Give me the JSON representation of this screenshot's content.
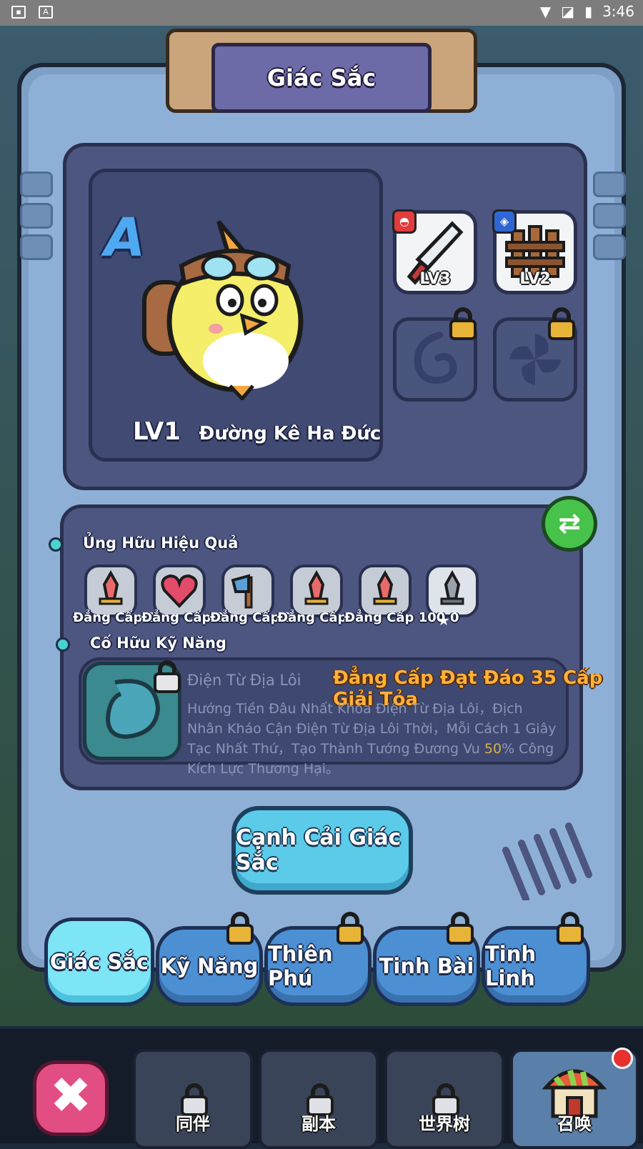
{
  "status_bar": {
    "time": "3:46",
    "icons": [
      "image-icon",
      "text-icon",
      "wifi-icon",
      "no-sim-icon",
      "battery-charging-icon"
    ]
  },
  "title": "Giác Sắc",
  "character": {
    "grade": "A",
    "level": "LV1",
    "name": "Đường Kê Ha Đức"
  },
  "equipment": [
    {
      "label": "LV3",
      "icon": "knife-icon",
      "badge": "bell-icon",
      "badge_color": "#e23c3c"
    },
    {
      "label": "LV2",
      "icon": "fence-icon",
      "badge": "shield-icon",
      "badge_color": "#2e66d6"
    },
    {
      "label": "",
      "icon": "swirl-icon",
      "locked": true
    },
    {
      "label": "",
      "icon": "fan-icon",
      "locked": true
    }
  ],
  "effects": {
    "section_title": "Ủng Hữu Hiệu Quả",
    "buffs": [
      {
        "icon": "sword-icon",
        "label": "Đẳng Cấp 1"
      },
      {
        "icon": "heart-icon",
        "label": "Đẳng Cấp 2"
      },
      {
        "icon": "axe-icon",
        "label": "Đẳng Cấp 5"
      },
      {
        "icon": "sword-icon",
        "label": "Đẳng Cấp"
      },
      {
        "icon": "sword-icon",
        "label": "Đẳng Cấp 100"
      },
      {
        "icon": "silver-sword-icon",
        "label": "0"
      }
    ]
  },
  "skill": {
    "section_title": "Cố Hữu Kỹ Năng",
    "name": "Điện Từ Địa Lôi",
    "requirement": "Đẳng Cấp Đạt Đáo 35 Cấp Giải Tỏa",
    "desc_1": "Hướng Tiền Đâu Nhất Khỏa Điện Từ Địa Lôi，Địch Nhân Kháo Cận Điện Từ Địa Lôi Thời，Mỗi Cách 1 Giây Tạc Nhất Thứ，Tạo Thành Tướng Đương Vu ",
    "desc_value": "50",
    "desc_2": "% Công Kích Lực Thương Hại。"
  },
  "upgrade_button": "Cạnh Cải Giác Sắc",
  "tabs": [
    {
      "label": "Giác Sắc",
      "locked": false
    },
    {
      "label": "Kỹ Năng",
      "locked": true
    },
    {
      "label": "Thiên Phú",
      "locked": true
    },
    {
      "label": "Tinh Bài",
      "locked": true
    },
    {
      "label": "Tinh Linh",
      "locked": true
    }
  ],
  "bottom_nav": [
    {
      "label": "同伴",
      "locked": true
    },
    {
      "label": "副本",
      "locked": true
    },
    {
      "label": "世界树",
      "locked": true
    },
    {
      "label": "召唤",
      "locked": false
    }
  ],
  "colors": {
    "panel": "#8eb0d6",
    "dark_box": "#4c5680",
    "accent_cyan": "#5ccbea",
    "tab_blue": "#4c8fd3",
    "gold_text": "#ffb13b"
  }
}
